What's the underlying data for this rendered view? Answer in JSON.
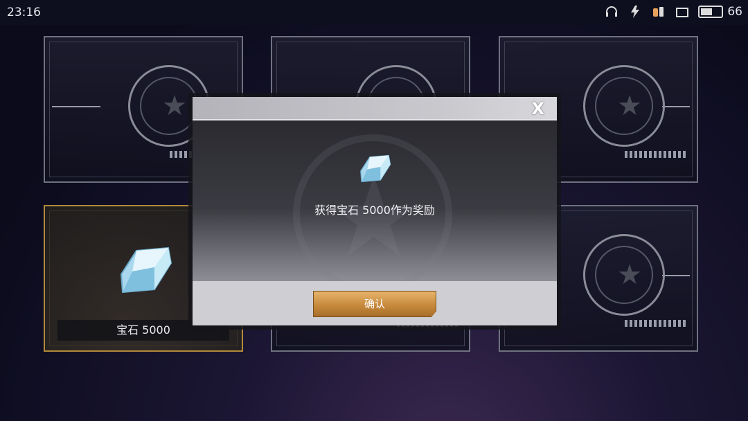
{
  "status_bar": {
    "time": "23:16",
    "battery_level": "66",
    "battery_fraction": 0.66,
    "icons": [
      "headset-icon",
      "signal-icon",
      "notification-icon",
      "screen-icon"
    ]
  },
  "cards": [
    {
      "state": "locked"
    },
    {
      "state": "locked"
    },
    {
      "state": "locked"
    },
    {
      "state": "revealed",
      "label": "宝石 5000"
    },
    {
      "state": "locked"
    },
    {
      "state": "locked"
    }
  ],
  "modal": {
    "close_label": "X",
    "message": "获得宝石 5000作为奖励",
    "confirm_label": "确认"
  },
  "colors": {
    "accent_gold": "#c78a3c",
    "selected_border": "#b28a3a",
    "gem": "#bfe6f5"
  }
}
